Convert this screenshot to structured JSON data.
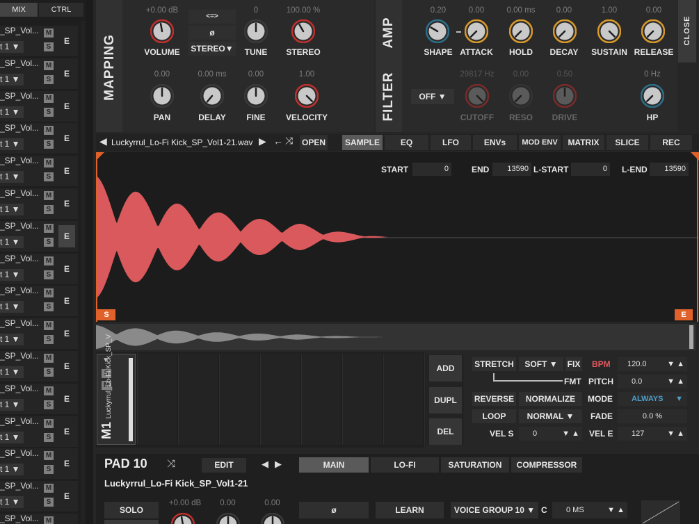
{
  "left_panel": {
    "tabs": [
      {
        "label": "MIX"
      },
      {
        "label": "CTRL"
      }
    ],
    "tracks": [
      {
        "name": "_SP_Vol...",
        "out": "t 1 ▼",
        "mute": "M",
        "solo": "S",
        "edit": "E"
      },
      {
        "name": "_SP_Vol...",
        "out": "t 1 ▼",
        "mute": "M",
        "solo": "S",
        "edit": "E"
      },
      {
        "name": "_SP_Vol...",
        "out": "t 1 ▼",
        "mute": "M",
        "solo": "S",
        "edit": "E"
      },
      {
        "name": "_SP_Vol...",
        "out": "t 1 ▼",
        "mute": "M",
        "solo": "S",
        "edit": "E"
      },
      {
        "name": "_SP_Vol...",
        "out": "t 1 ▼",
        "mute": "M",
        "solo": "S",
        "edit": "E"
      },
      {
        "name": "_SP_Vol...",
        "out": "t 1 ▼",
        "mute": "M",
        "solo": "S",
        "edit": "E"
      },
      {
        "name": "_SP_Vol...",
        "out": "t 1 ▼",
        "mute": "M",
        "solo": "S",
        "edit": "E"
      },
      {
        "name": "_SP_Vol...",
        "out": "t 1 ▼",
        "mute": "M",
        "solo": "S",
        "edit": "E"
      },
      {
        "name": "_SP_Vol...",
        "out": "t 1 ▼",
        "mute": "M",
        "solo": "S",
        "edit": "E"
      },
      {
        "name": "_SP_Vol...",
        "out": "t 1 ▼",
        "mute": "M",
        "solo": "S",
        "edit": "E"
      },
      {
        "name": "_SP_Vol...",
        "out": "t 1 ▼",
        "mute": "M",
        "solo": "S",
        "edit": "E"
      },
      {
        "name": "_SP_Vol...",
        "out": "t 1 ▼",
        "mute": "M",
        "solo": "S",
        "edit": "E"
      },
      {
        "name": "_SP_Vol...",
        "out": "t 1 ▼",
        "mute": "M",
        "solo": "S",
        "edit": "E"
      },
      {
        "name": "_SP_Vol...",
        "out": "t 1 ▼",
        "mute": "M",
        "solo": "S",
        "edit": "E"
      },
      {
        "name": "_SP_Vol...",
        "out": "t 1 ▼",
        "mute": "M",
        "solo": "S",
        "edit": "E"
      },
      {
        "name": "_SP_Vol...",
        "out": "t 1 ▼",
        "mute": "M",
        "solo": "S",
        "edit": "E"
      }
    ],
    "selected_track": 6
  },
  "mapping": {
    "title": "MAPPING",
    "volume": {
      "label": "VOLUME",
      "value": "+0.00 dB"
    },
    "link_btn": "<=>",
    "phase_btn": "ø",
    "stereo_mode": "STEREO▼",
    "tune": {
      "label": "TUNE",
      "value": "0"
    },
    "stereo": {
      "label": "STEREO",
      "value": "100.00 %"
    },
    "pan": {
      "label": "PAN",
      "value": "0.00"
    },
    "delay": {
      "label": "DELAY",
      "value": "0.00 ms"
    },
    "fine": {
      "label": "FINE",
      "value": "0.00"
    },
    "velocity": {
      "label": "VELOCITY",
      "value": "1.00"
    }
  },
  "amp": {
    "title": "AMP",
    "shape": {
      "label": "SHAPE",
      "value": "0.20"
    },
    "attack": {
      "label": "ATTACK",
      "value": "0.00"
    },
    "hold": {
      "label": "HOLD",
      "value": "0.00 ms"
    },
    "decay": {
      "label": "DECAY",
      "value": "0.00"
    },
    "sustain": {
      "label": "SUSTAIN",
      "value": "1.00"
    },
    "release": {
      "label": "RELEASE",
      "value": "0.00"
    }
  },
  "filter": {
    "title": "FILTER",
    "mode": "OFF",
    "cutoff": {
      "label": "CUTOFF",
      "value": "29817 Hz"
    },
    "reso": {
      "label": "RESO",
      "value": "0.00"
    },
    "drive": {
      "label": "DRIVE",
      "value": "0.50"
    },
    "hp": {
      "label": "HP",
      "value": "0 Hz"
    }
  },
  "close_label": "CLOSE",
  "sample_bar": {
    "filename": "Luckyrrul_Lo-Fi Kick_SP_Vol1-21.wav",
    "open_label": "OPEN",
    "tabs": [
      {
        "label": "SAMPLE"
      },
      {
        "label": "EQ"
      },
      {
        "label": "LFO"
      },
      {
        "label": "ENVs"
      },
      {
        "label": "MOD ENV"
      },
      {
        "label": "MATRIX"
      },
      {
        "label": "SLICE"
      },
      {
        "label": "REC"
      }
    ],
    "active_tab": 0
  },
  "points": {
    "start_label": "START",
    "start_value": "0",
    "end_label": "END",
    "end_value": "13590",
    "lstart_label": "L-START",
    "lstart_value": "0",
    "lend_label": "L-END",
    "lend_value": "13590"
  },
  "markers": {
    "start": "S",
    "end": "E"
  },
  "slices": {
    "mute": "M",
    "solo": "S",
    "name": "M1",
    "sample": "Luckyrrul_Lo-Fi Kick_SP_V",
    "add": "ADD",
    "dupl": "DUPL",
    "del": "DEL"
  },
  "controls": {
    "stretch": "STRETCH",
    "soft": "SOFT ▼",
    "fix": "FIX",
    "fmt": "FMT",
    "bpm_label": "BPM",
    "bpm_value": "120.0",
    "pitch_label": "PITCH",
    "pitch_value": "0.0",
    "reverse": "REVERSE",
    "normalize": "NORMALIZE",
    "mode_label": "MODE",
    "mode_value": "ALWAYS",
    "loop": "LOOP",
    "loop_mode": "NORMAL",
    "fade_label": "FADE",
    "fade_value": "0.0 %",
    "vels_label": "VEL S",
    "vels_value": "0",
    "vele_label": "VEL E",
    "vele_value": "127"
  },
  "pad": {
    "title": "PAD 10",
    "edit": "EDIT",
    "tabs": [
      {
        "label": "MAIN"
      },
      {
        "label": "LO-FI"
      },
      {
        "label": "SATURATION"
      },
      {
        "label": "COMPRESSOR"
      }
    ],
    "active_tab": 0,
    "sample_name": "Luckyrrul_Lo-Fi Kick_SP_Vol1-21"
  },
  "bottom": {
    "solo": "SOLO",
    "volume_value": "+0.00 dB",
    "value2": "0.00",
    "value3": "0.00",
    "phase": "ø",
    "learn": "LEARN",
    "voice_group": "VOICE GROUP 10 ▼",
    "c_label": "C",
    "ms_value": "0 MS"
  },
  "colors": {
    "accent": "#e0585f",
    "waveform": "#d9595c",
    "marker": "#e0622a",
    "knob_ring": "#c0302d",
    "amp_ring": "#d89a2b",
    "always": "#4f9fc9"
  }
}
